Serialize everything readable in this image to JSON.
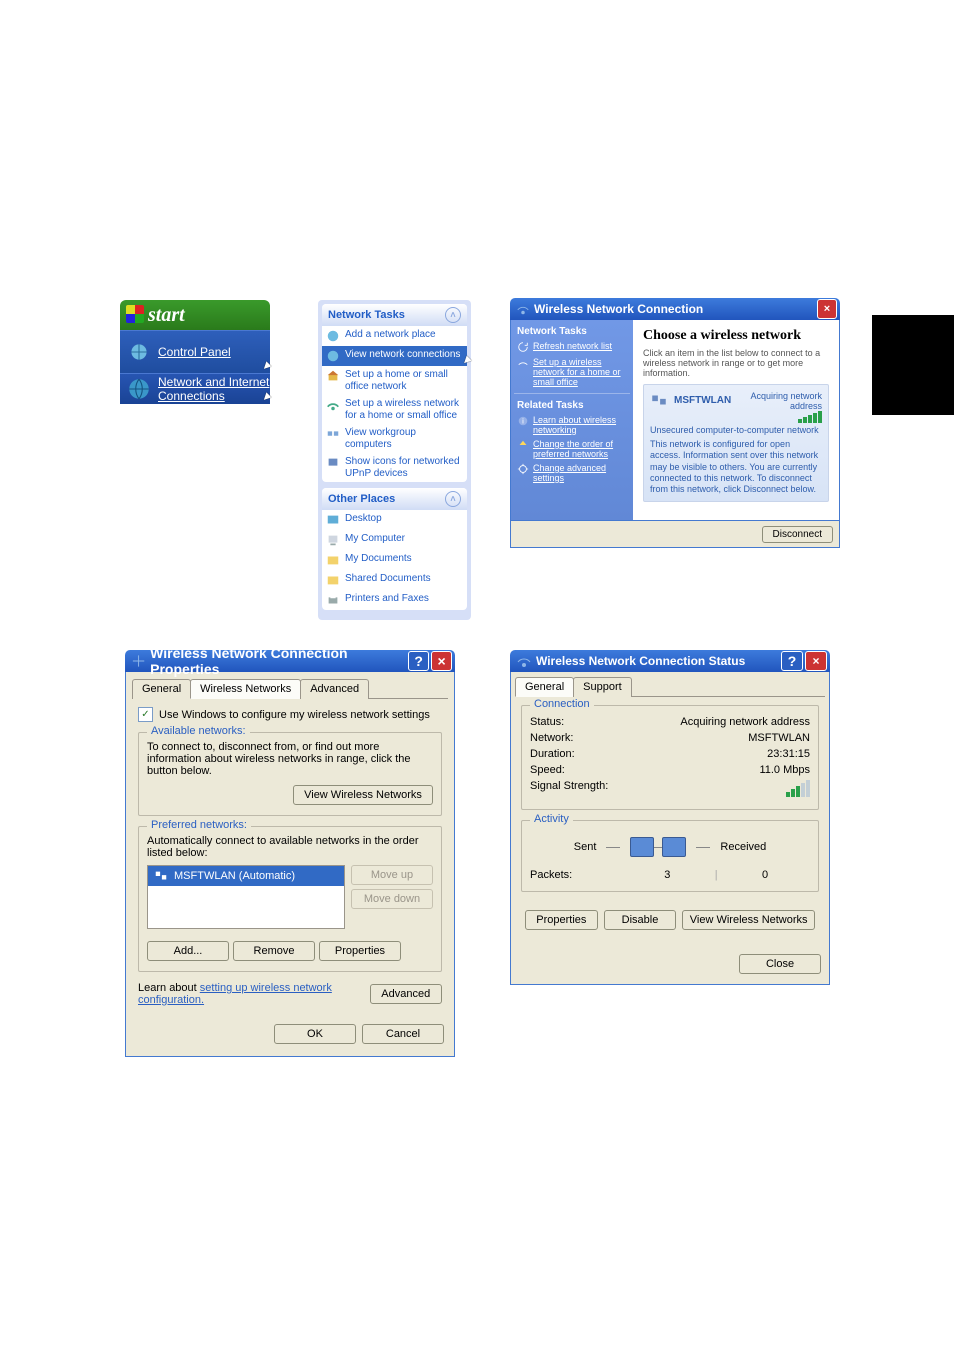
{
  "upleft": {
    "start": "start",
    "control_panel": "Control Panel",
    "netconn": "Network and Internet Connections"
  },
  "sidebar": {
    "group1_title": "Network Tasks",
    "group1_items": [
      "Add a network place",
      "View network connections",
      "Set up a home or small office network",
      "Set up a wireless network for a home or small office",
      "View workgroup computers",
      "Show icons for networked UPnP devices"
    ],
    "group2_title": "Other Places",
    "group2_items": [
      "Desktop",
      "My Computer",
      "My Documents",
      "Shared Documents",
      "Printers and Faxes"
    ]
  },
  "wlan": {
    "title": "Wireless Network Connection",
    "left_hd1": "Network Tasks",
    "left_links1": [
      "Refresh network list",
      "Set up a wireless network for a home or small office"
    ],
    "left_hd2": "Related Tasks",
    "left_links2": [
      "Learn about wireless networking",
      "Change the order of preferred networks",
      "Change advanced settings"
    ],
    "right_hd": "Choose a wireless network",
    "right_sub": "Click an item in the list below to connect to a wireless network in range or to get more information.",
    "item_name": "MSFTWLAN",
    "item_status": "Acquiring network address",
    "item_unsec": "Unsecured computer-to-computer network",
    "item_desc": "This network is configured for open access. Information sent over this network may be visible to others. You are currently connected to this network. To disconnect from this network, click Disconnect below.",
    "disconnect": "Disconnect"
  },
  "props": {
    "title": "Wireless Network Connection Properties",
    "tabs": [
      "General",
      "Wireless Networks",
      "Advanced"
    ],
    "check": "Use Windows to configure my wireless network settings",
    "avail_leg": "Available networks:",
    "avail_text": "To connect to, disconnect from, or find out more information about wireless networks in range, click the button below.",
    "view_btn": "View Wireless Networks",
    "pref_leg": "Preferred networks:",
    "pref_text": "Automatically connect to available networks in the order listed below:",
    "pref_item": "MSFTWLAN (Automatic)",
    "move_up": "Move up",
    "move_down": "Move down",
    "add": "Add...",
    "remove": "Remove",
    "properties": "Properties",
    "learn": "Learn about ",
    "learn_link": "setting up wireless network configuration.",
    "adv": "Advanced",
    "ok": "OK",
    "cancel": "Cancel"
  },
  "status": {
    "title": "Wireless Network Connection Status",
    "tabs": [
      "General",
      "Support"
    ],
    "conn_leg": "Connection",
    "rows": {
      "Status:": "Acquiring network address",
      "Network:": "MSFTWLAN",
      "Duration:": "23:31:15",
      "Speed:": "11.0 Mbps",
      "Signal Strength:": ""
    },
    "act_leg": "Activity",
    "sent": "Sent",
    "recv": "Received",
    "packets": "Packets:",
    "sent_val": "3",
    "recv_val": "0",
    "properties": "Properties",
    "disable": "Disable",
    "view": "View Wireless Networks",
    "close": "Close"
  }
}
